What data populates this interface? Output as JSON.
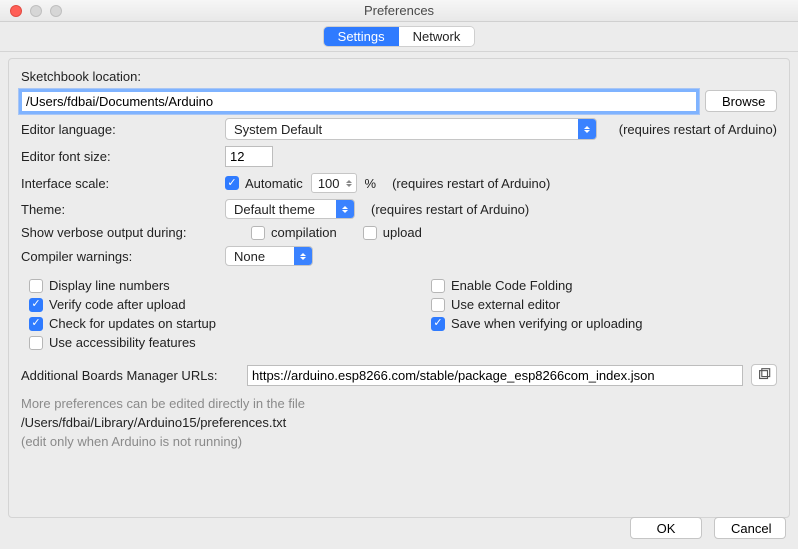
{
  "window": {
    "title": "Preferences"
  },
  "tabs": {
    "settings": "Settings",
    "network": "Network"
  },
  "sketchbook": {
    "label": "Sketchbook location:",
    "path": "/Users/fdbai/Documents/Arduino",
    "browse": "Browse"
  },
  "language": {
    "label": "Editor language:",
    "value": "System Default",
    "hint": "(requires restart of Arduino)"
  },
  "fontsize": {
    "label": "Editor font size:",
    "value": "12"
  },
  "scale": {
    "label": "Interface scale:",
    "auto_label": "Automatic",
    "auto_checked": true,
    "value": "100",
    "unit": "%",
    "hint": "(requires restart of Arduino)"
  },
  "theme": {
    "label": "Theme:",
    "value": "Default theme",
    "hint": "(requires restart of Arduino)"
  },
  "verbose": {
    "label": "Show verbose output during:",
    "compilation": "compilation",
    "upload": "upload"
  },
  "warnings": {
    "label": "Compiler warnings:",
    "value": "None"
  },
  "options": {
    "display_line_numbers": "Display line numbers",
    "display_line_numbers_checked": false,
    "verify_after_upload": "Verify code after upload",
    "verify_after_upload_checked": true,
    "check_updates": "Check for updates on startup",
    "check_updates_checked": true,
    "accessibility": "Use accessibility features",
    "accessibility_checked": false,
    "code_folding": "Enable Code Folding",
    "code_folding_checked": false,
    "external_editor": "Use external editor",
    "external_editor_checked": false,
    "save_when_verify": "Save when verifying or uploading",
    "save_when_verify_checked": true
  },
  "boards": {
    "label": "Additional Boards Manager URLs:",
    "value": "https://arduino.esp8266.com/stable/package_esp8266com_index.json"
  },
  "note": {
    "line1": "More preferences can be edited directly in the file",
    "path": "/Users/fdbai/Library/Arduino15/preferences.txt",
    "line2": "(edit only when Arduino is not running)"
  },
  "buttons": {
    "ok": "OK",
    "cancel": "Cancel"
  }
}
